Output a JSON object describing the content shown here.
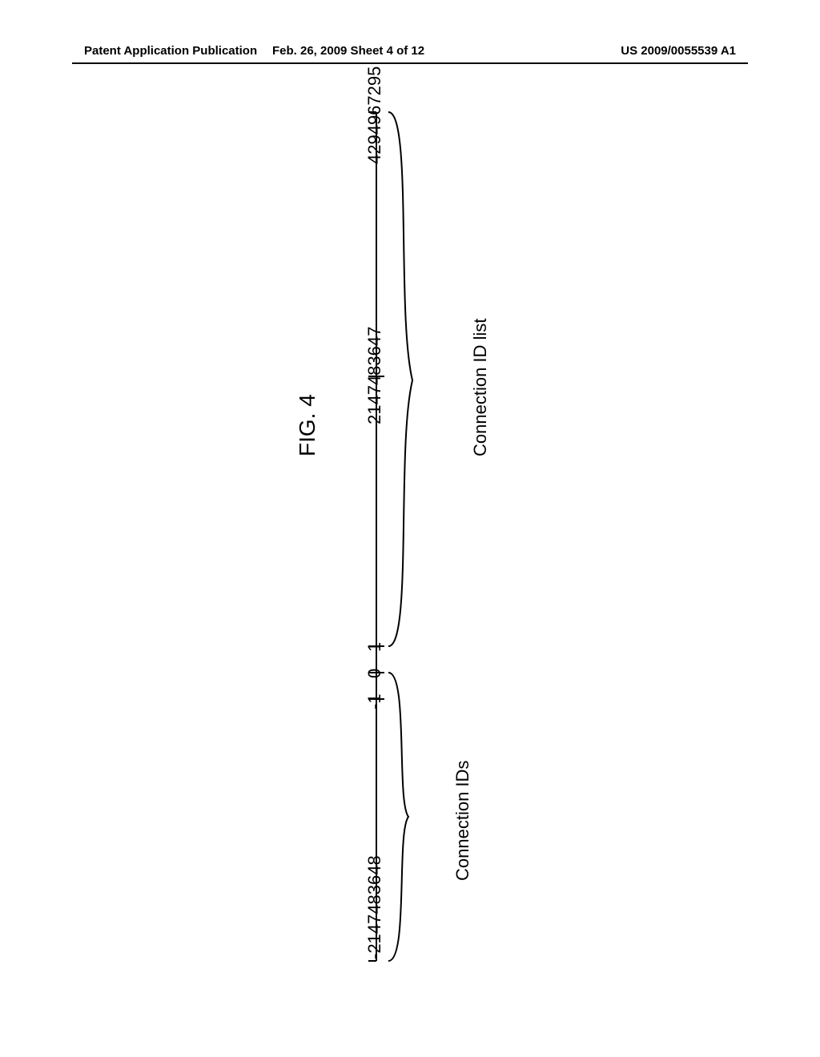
{
  "header": {
    "left": "Patent Application Publication",
    "center": "Feb. 26, 2009  Sheet 4 of 12",
    "right": "US 2009/0055539 A1"
  },
  "figure": {
    "title": "FIG. 4",
    "ticks": {
      "min": "-2147483648",
      "neg1": "-1",
      "zero": "0",
      "one": "1",
      "mid": "2147483647",
      "max": "4294967295"
    },
    "labels": {
      "ids": "Connection IDs",
      "list": "Connection ID list"
    }
  },
  "chart_data": {
    "type": "diagram",
    "description": "Number line showing signed 32-bit range used for Connection IDs and unsigned extension used for Connection ID list",
    "axis_values": [
      -2147483648,
      -1,
      0,
      1,
      2147483647,
      4294967295
    ],
    "ranges": [
      {
        "name": "Connection IDs",
        "from": -2147483648,
        "to": 0
      },
      {
        "name": "Connection ID list",
        "from": 1,
        "to": 4294967295
      }
    ]
  }
}
